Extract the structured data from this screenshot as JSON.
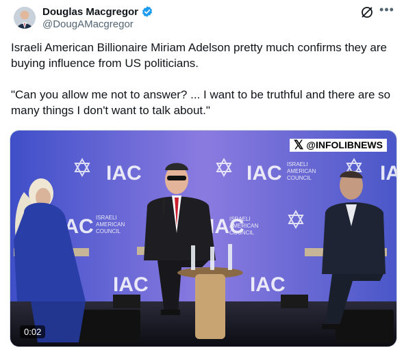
{
  "author": {
    "display_name": "Douglas Macgregor",
    "handle": "@DougAMacgregor",
    "verified": true
  },
  "tweet": {
    "line1": "Israeli American Billionaire Miriam Adelson pretty much confirms they are buying influence from US politicians.",
    "line2": "\"Can you allow me not to answer? ... I want to be truthful and there are so many things I don't want to talk about.\""
  },
  "media": {
    "badge": "@INFOLIBNEWS",
    "timestamp": "0:02",
    "backdrop_logo": "IAC",
    "backdrop_sub": [
      "ISRAELI",
      "AMERICAN",
      "COUNCIL"
    ]
  },
  "colors": {
    "verified_blue": "#1d9bf0",
    "stage_purple": "#5a5fd0",
    "text_primary": "#0f1419",
    "text_secondary": "#536471"
  },
  "icons": [
    "verified-badge-icon",
    "grok-icon",
    "more-icon",
    "x-logo-icon"
  ]
}
